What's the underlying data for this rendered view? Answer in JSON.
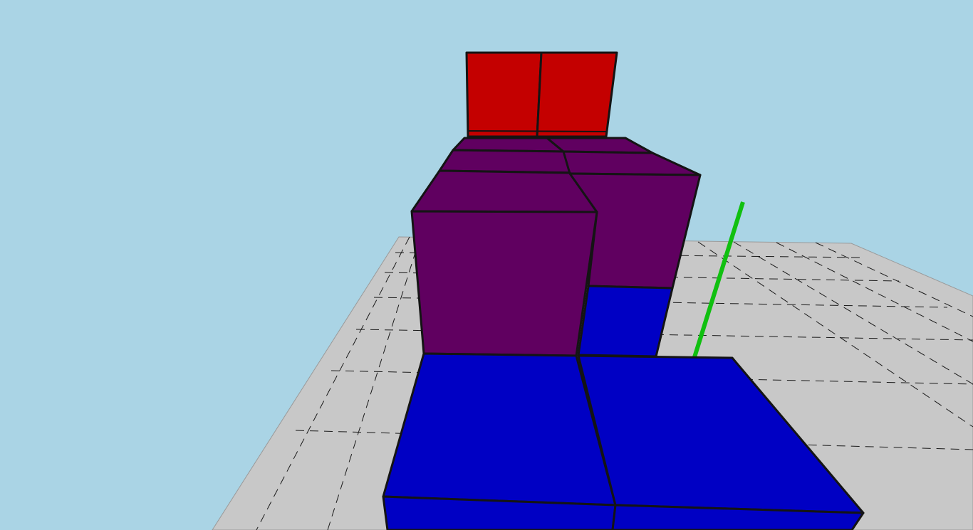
{
  "scene": {
    "type": "3d-voxel-viewport",
    "colors": {
      "sky": "#aad4e5",
      "ground": "#c8c8c8",
      "grid_line": "#1a1a1a",
      "edge": "#141414",
      "red_block": "#c40000",
      "purple_block": "#600060",
      "blue_block": "#0000c4",
      "axis_y": "#10c010"
    },
    "blocks": {
      "red": 2,
      "purple": 4,
      "blue": 4
    },
    "ground_plane": {
      "grid": true,
      "line_style": "dashed"
    },
    "axis_indicator": {
      "color_name": "green",
      "axis": "y"
    }
  }
}
